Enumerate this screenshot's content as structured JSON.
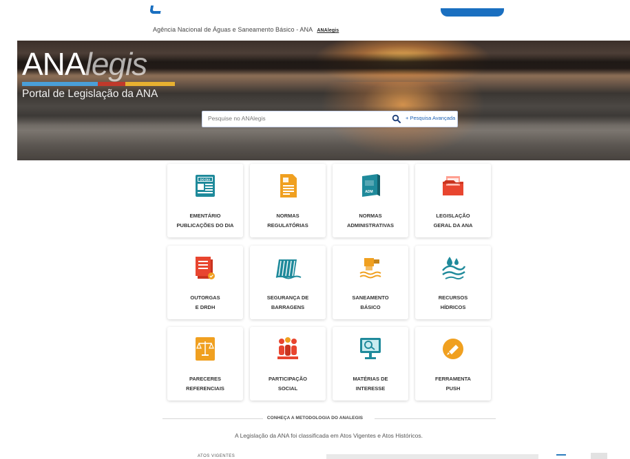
{
  "header": {
    "breadcrumb_text": "Agência Nacional de Águas e Saneamento Básico - ANA",
    "breadcrumb_logo": "ANAlegis"
  },
  "hero": {
    "brand_ana": "ANA",
    "brand_legis": "legis",
    "brand_subtitle": "Portal de Legislação da ANA",
    "brand_bar_colors": [
      "#4a9fd8",
      "#c0392b",
      "#e8b030"
    ],
    "search_placeholder": "Pesquise no ANAlegis",
    "search_icon": "search-icon",
    "advanced_search_label": "+ Pesquisa Avançada"
  },
  "cards": [
    {
      "line1": "EMENTÁRIO",
      "line2": "PUBLICAÇÕES DO DIA",
      "icon": "newspaper-icon",
      "color": "#1f8a9b"
    },
    {
      "line1": "NORMAS",
      "line2": "REGULATÓRIAS",
      "icon": "document-icon",
      "color": "#f0a020"
    },
    {
      "line1": "NORMAS",
      "line2": "ADMINISTRATIVAS",
      "icon": "adm-book-icon",
      "color": "#1f8a9b"
    },
    {
      "line1": "LEGISLAÇÃO",
      "line2": "GERAL DA ANA",
      "icon": "folder-icon",
      "color": "#e8452f"
    },
    {
      "line1": "OUTORGAS",
      "line2": "E DRDH",
      "icon": "documents-stack-icon",
      "color": "#e8452f"
    },
    {
      "line1": "SEGURANÇA DE",
      "line2": "BARRAGENS",
      "icon": "dam-icon",
      "color": "#1f8a9b"
    },
    {
      "line1": "SANEAMENTO",
      "line2": "BÁSICO",
      "icon": "pipe-water-icon",
      "color": "#f0a020"
    },
    {
      "line1": "RECURSOS",
      "line2": "HÍDRICOS",
      "icon": "water-resources-icon",
      "color": "#1f8a9b"
    },
    {
      "line1": "PARECERES",
      "line2": "REFERENCIAIS",
      "icon": "scales-document-icon",
      "color": "#f0a020"
    },
    {
      "line1": "PARTICIPAÇÃO",
      "line2": "SOCIAL",
      "icon": "people-icon",
      "color": "#e8452f"
    },
    {
      "line1": "MATÉRIAS DE",
      "line2": "INTERESSE",
      "icon": "monitor-search-icon",
      "color": "#1f8a9b"
    },
    {
      "line1": "FERRAMENTA",
      "line2": "PUSH",
      "icon": "push-bell-icon",
      "color": "#f0a020"
    }
  ],
  "methodology": {
    "title": "CONHEÇA A METODOLOGIA DO ANALEGIS",
    "text": "A Legislação da ANA foi classificada em Atos Vigentes e Atos Históricos.",
    "partial_heading": "ATOS VIGENTES"
  }
}
